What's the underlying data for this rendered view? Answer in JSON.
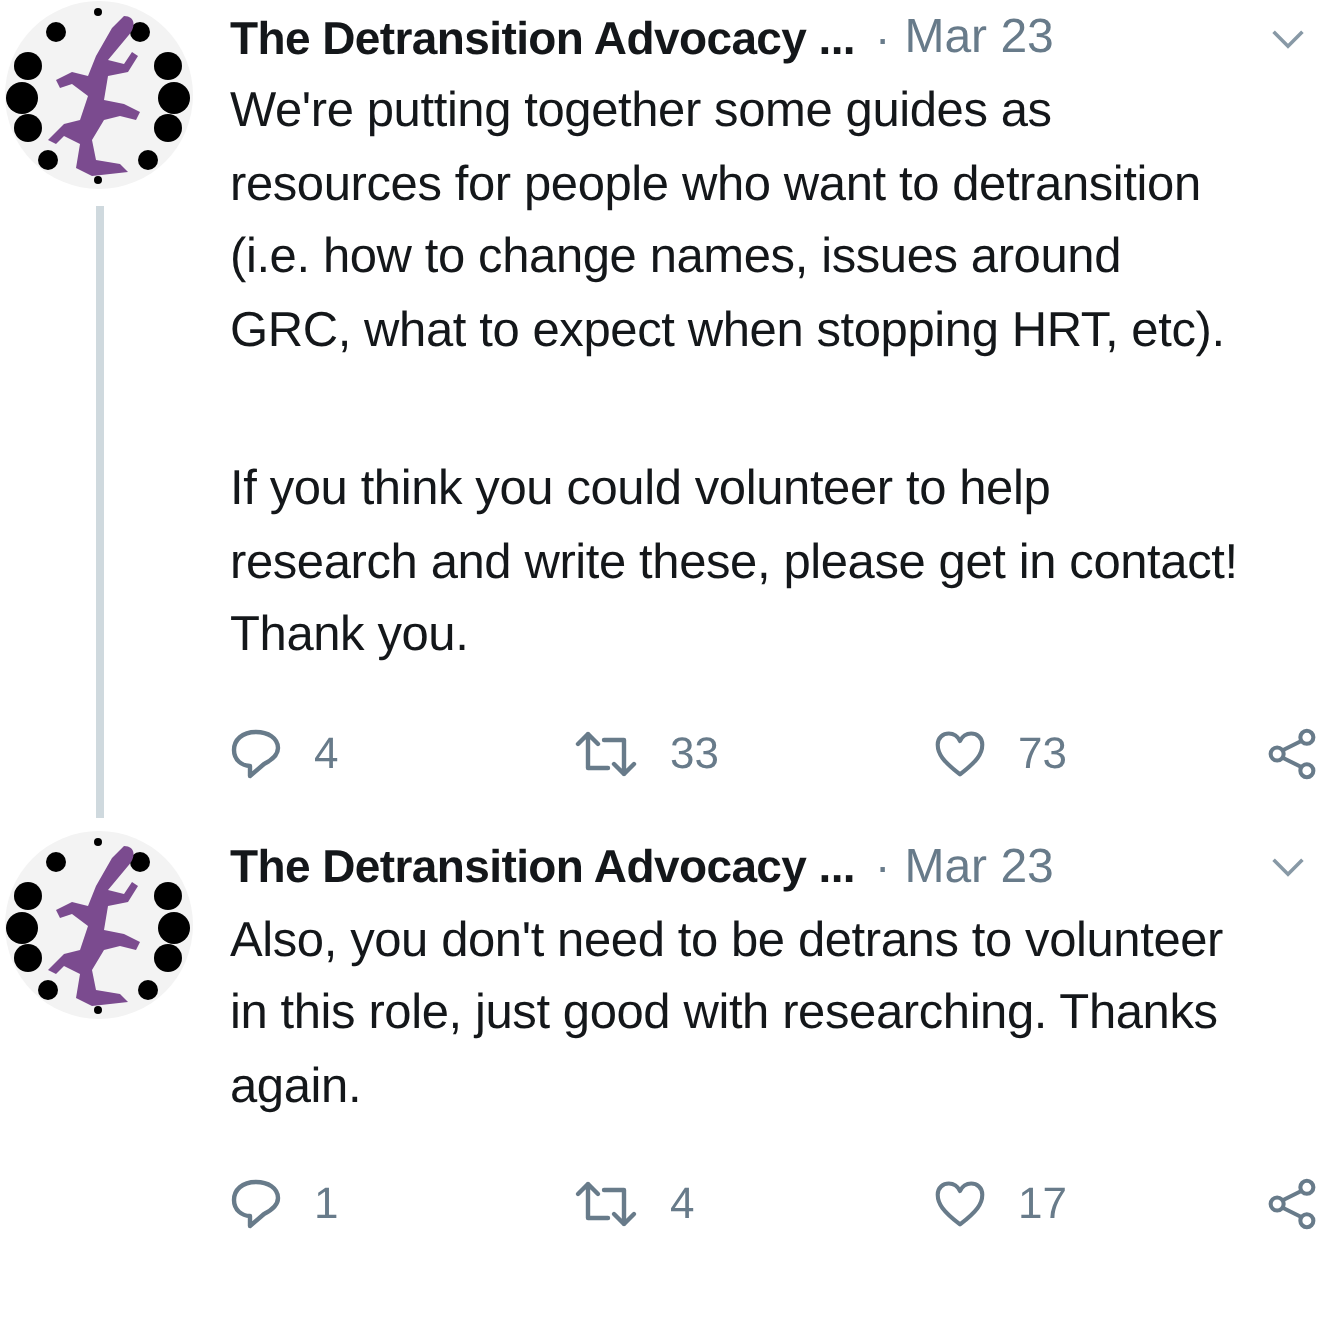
{
  "tweets": [
    {
      "author": "The Detransition Advocacy ...",
      "separator": "·",
      "date": "Mar 23",
      "paragraphs": [
        "We're putting together some guides as resources for people who want to detransition (i.e. how to change names, issues around GRC, what to expect when stopping HRT, etc).",
        "If you think you could volunteer to help research and write these, please get in contact! Thank you."
      ],
      "replies": "4",
      "retweets": "33",
      "likes": "73",
      "thread_line": true
    },
    {
      "author": "The Detransition Advocacy ...",
      "separator": "·",
      "date": "Mar 23",
      "paragraphs": [
        "Also, you don't need to be detrans to volunteer in this role, just good with researching. Thanks again."
      ],
      "replies": "1",
      "retweets": "4",
      "likes": "17",
      "thread_line": false
    }
  ]
}
